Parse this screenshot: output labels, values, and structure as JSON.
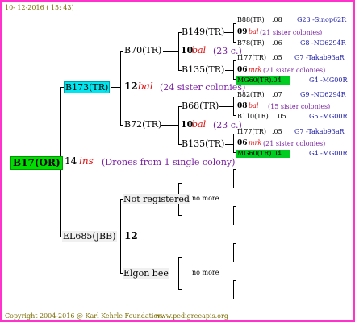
{
  "header": {
    "date": "10- 12-2016 ( 15: 43)"
  },
  "footer": {
    "copyright": "Copyright 2004-2016 @ Karl Kehrle Foundation.",
    "url": "www.pedigreeapis.org"
  },
  "colors": {
    "border": "#ff33cc",
    "root_bg": "#00dd00",
    "gen1_bg": "#00e5ee",
    "highlight_bg": "#00cc22",
    "mark_red": "#e01010",
    "note_purple": "#7a1fa2",
    "link_blue": "#1a1aa8"
  },
  "root": {
    "id": "B17(OR)",
    "year": "14",
    "mark": "ins",
    "note": "(Drones from 1 single colony)"
  },
  "sire": {
    "id": "B173(TR)",
    "year": "12",
    "mark": "bal",
    "note": "(24 sister colonies)",
    "sire": {
      "id": "B70(TR)",
      "year": "10",
      "mark": "bal",
      "note": "(23 c.)",
      "sire": {
        "id": "B149(TR)",
        "year": "09",
        "mark": "bal",
        "note": "(21 sister colonies)",
        "sire": {
          "id": "B88(TR)",
          "year": ".08",
          "ref": "G23 -Sinop62R"
        },
        "dam": {
          "id": "B78(TR)",
          "year": ".06",
          "ref": "G8 -NO6294R"
        }
      },
      "dam": {
        "id": "B135(TR)",
        "year": "06",
        "mark": "mrk",
        "note": "(21 sister colonies)",
        "sire": {
          "id": "I177(TR)",
          "year": ".05",
          "ref": "G7 -Takab93aR"
        },
        "dam": {
          "id": "MG60(TR)",
          "year": ".04",
          "ref": "G4 -MG00R"
        }
      }
    },
    "dam": {
      "id": "B72(TR)",
      "year": "10",
      "mark": "bal",
      "note": "(23 c.)",
      "sire": {
        "id": "B68(TR)",
        "year": "08",
        "mark": "bal",
        "note": "(15 sister colonies)",
        "sire": {
          "id": "B82(TR)",
          "year": ".07",
          "ref": "G9 -NO6294R"
        },
        "dam": {
          "id": "B110(TR)",
          "year": ".05",
          "ref": "G5 -MG00R"
        }
      },
      "dam": {
        "id": "B135(TR)",
        "year": "06",
        "mark": "mrk",
        "note": "(21 sister colonies)",
        "sire": {
          "id": "I177(TR)",
          "year": ".05",
          "ref": "G7 -Takab93aR"
        },
        "dam": {
          "id": "MG60(TR)",
          "year": ".04",
          "ref": "G4 -MG00R"
        }
      }
    }
  },
  "dam": {
    "id": "EL685(JBB)",
    "year": "12",
    "sire": {
      "id": "Not registered",
      "note": "no more"
    },
    "dam": {
      "id": "Elgon bee",
      "note": "no more"
    }
  }
}
